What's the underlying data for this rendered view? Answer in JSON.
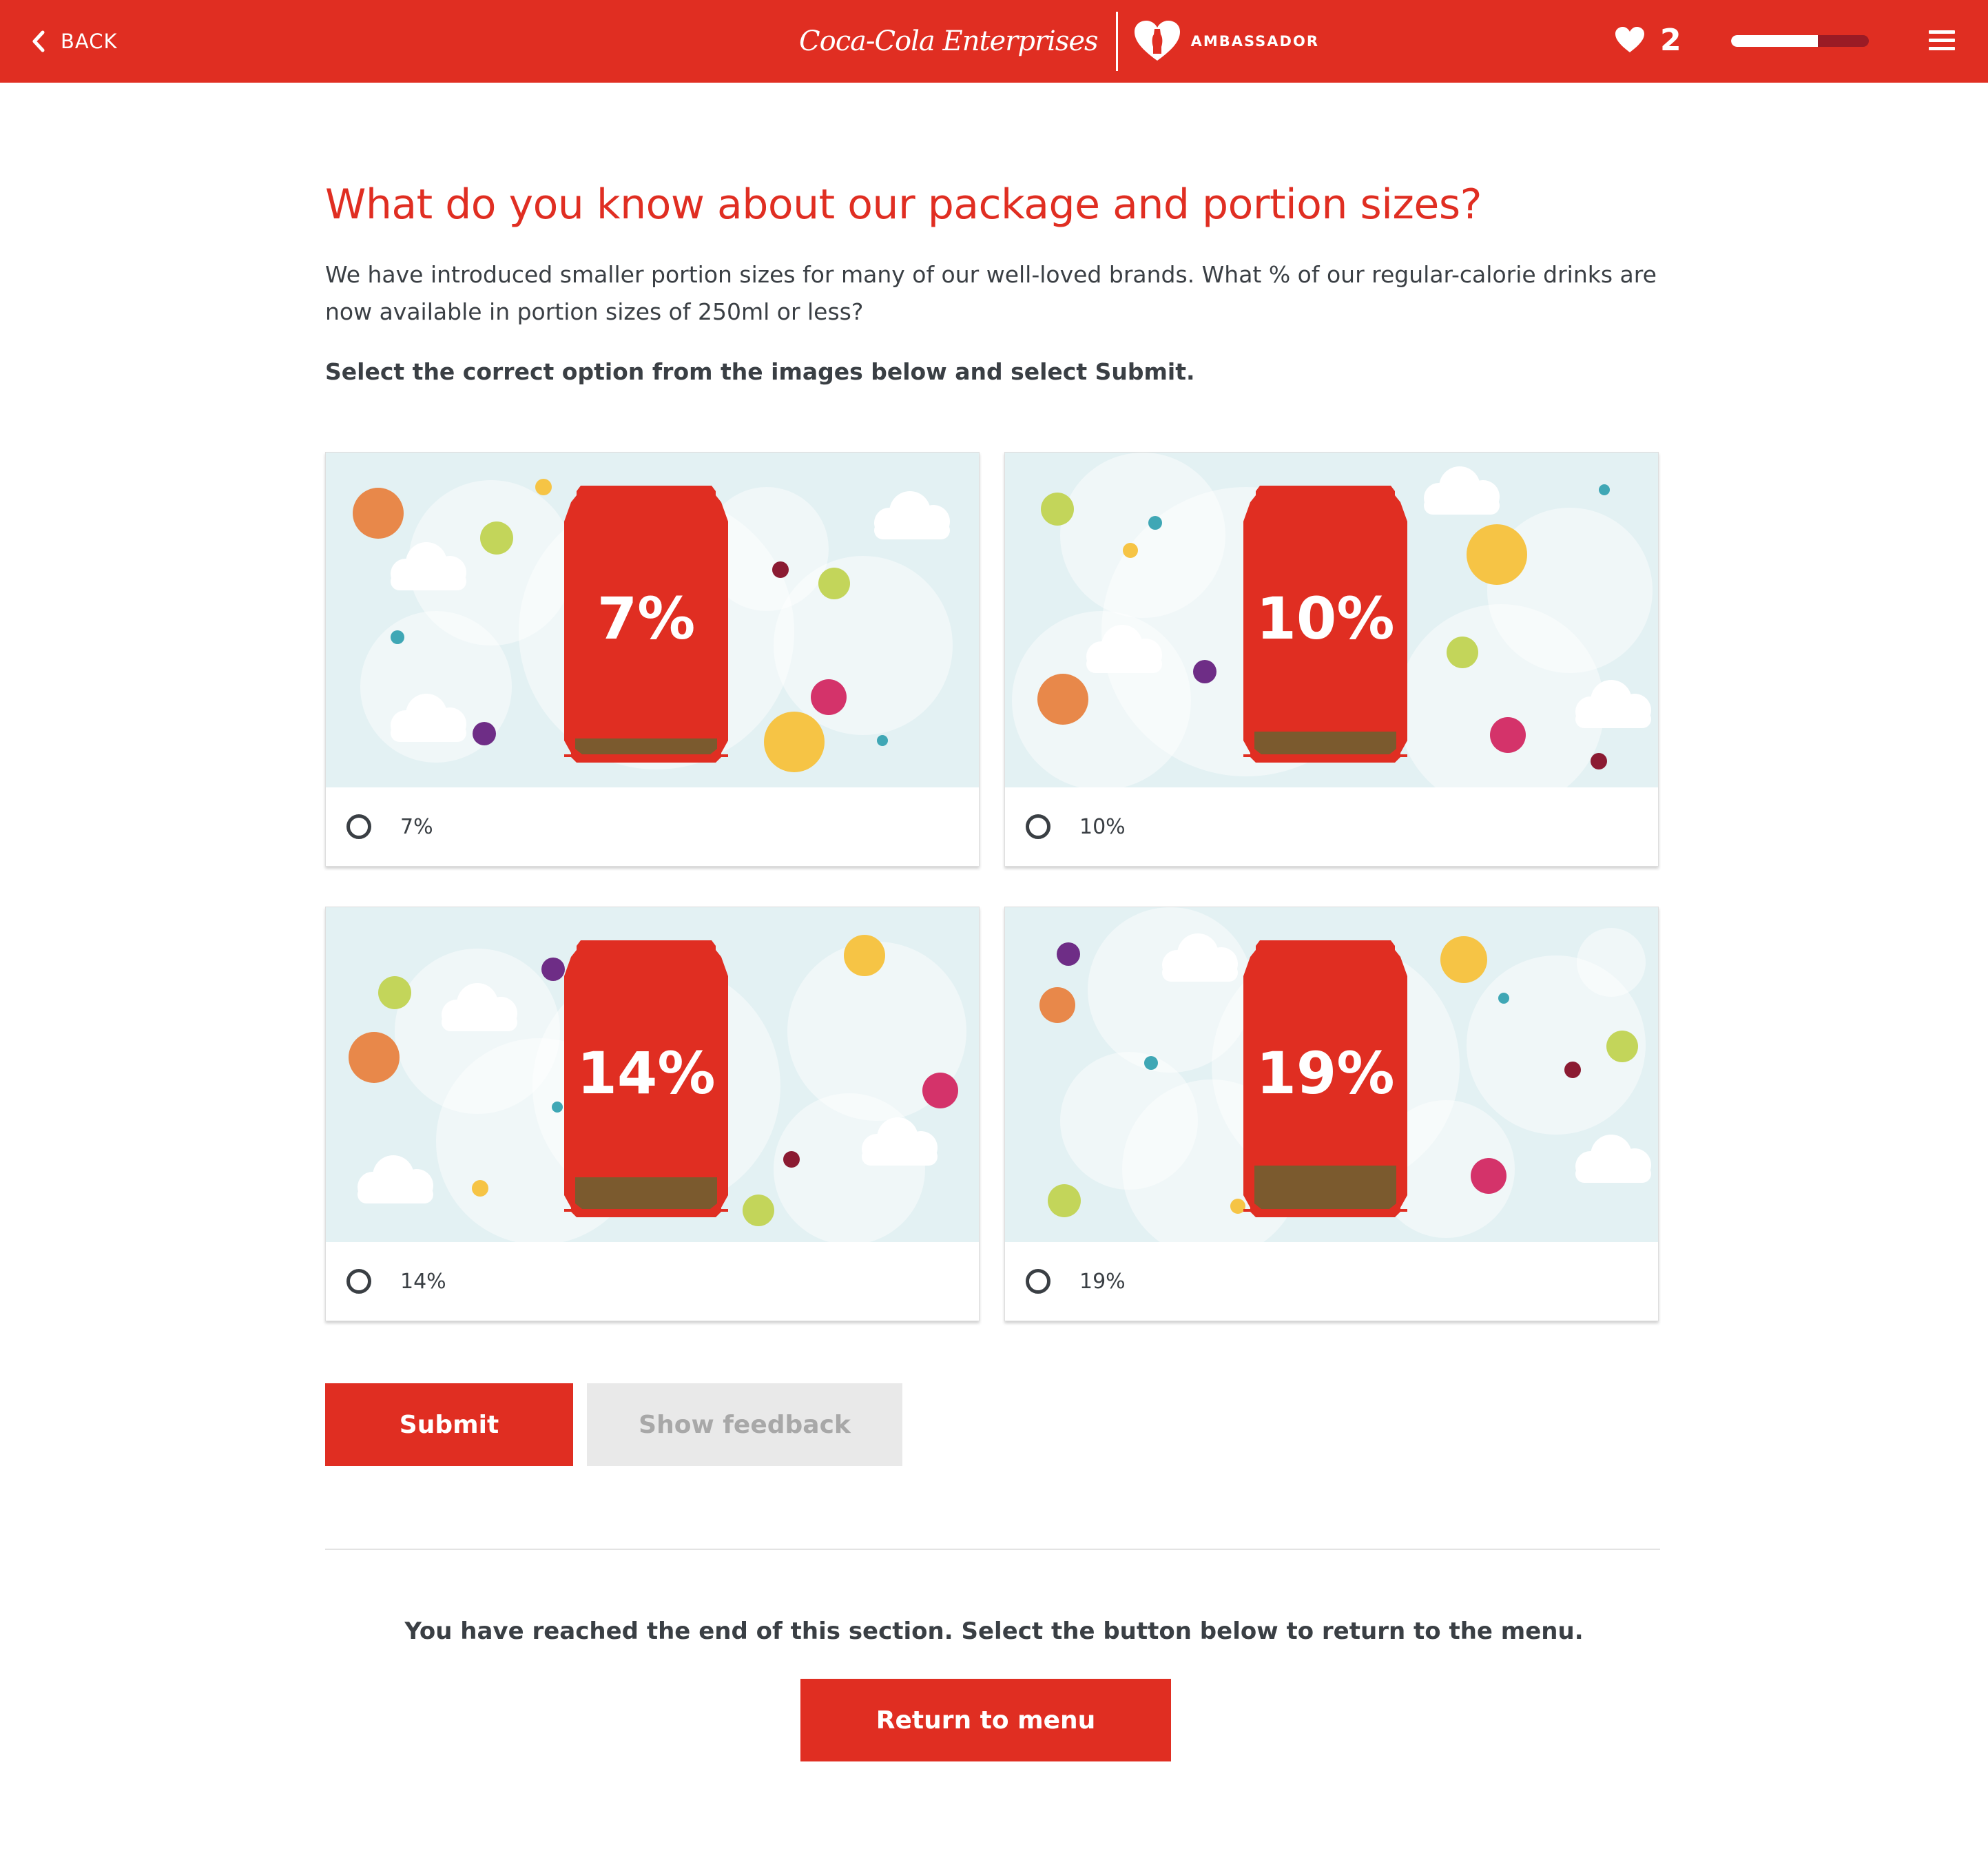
{
  "header": {
    "back_label": "BACK",
    "brand_name": "Coca-Cola Enterprises",
    "ambassador_label": "AMBASSADOR",
    "lives_count": "2",
    "progress_fraction": 0.63,
    "background_color": "#e02e22",
    "icons": {
      "back": "chevron-left-icon",
      "lives": "heart-icon",
      "menu": "hamburger-menu-icon"
    }
  },
  "question": {
    "title": "What do you know about our package and portion sizes?",
    "body": "We have introduced smaller portion sizes for many of our well-loved brands. What % of our regular-calorie drinks are now available in portion sizes of 250ml or less?",
    "instruction": "Select the correct option from the images below and select Submit."
  },
  "options": [
    {
      "label": "7%",
      "can_text": "7%",
      "fill_level": 0.07,
      "selected": false
    },
    {
      "label": "10%",
      "can_text": "10%",
      "fill_level": 0.1,
      "selected": false
    },
    {
      "label": "14%",
      "can_text": "14%",
      "fill_level": 0.14,
      "selected": false
    },
    {
      "label": "19%",
      "can_text": "19%",
      "fill_level": 0.19,
      "selected": false
    }
  ],
  "actions": {
    "submit_label": "Submit",
    "feedback_label": "Show feedback",
    "feedback_enabled": false
  },
  "footer": {
    "end_message": "You have reached the end of this section. Select the button below to return to the menu.",
    "return_label": "Return to menu"
  },
  "colors": {
    "accent": "#e02e22",
    "text": "#3a3f44",
    "illustration_bg": "#e3f1f3",
    "liquid": "#7b5a2e"
  }
}
